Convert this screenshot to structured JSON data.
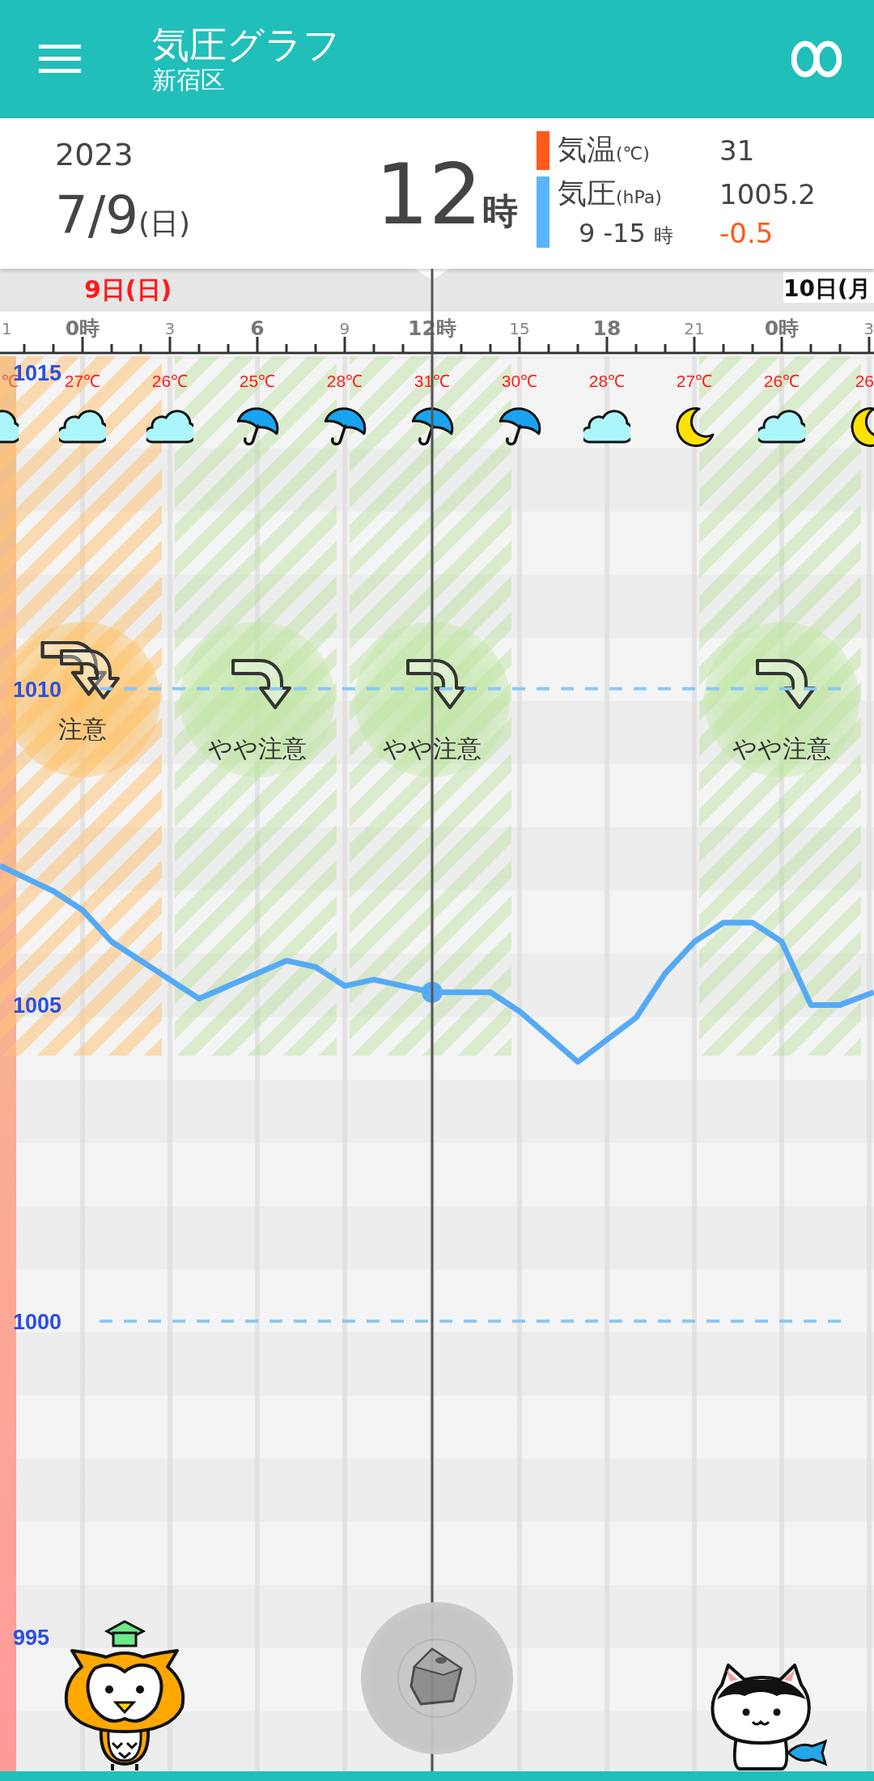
{
  "app_bar": {
    "title": "気圧グラフ",
    "subtitle": "新宿区"
  },
  "current": {
    "year": "2023",
    "date": "7/9",
    "weekday": "(日)",
    "hour": "12",
    "hour_unit": "時"
  },
  "legend": [
    {
      "label": "気温",
      "unit": "(℃)",
      "value": "31",
      "color": "#ff5a1a"
    },
    {
      "label": "気圧",
      "unit": "(hPa)",
      "value": "1005.2",
      "color": "#5ab4ff"
    }
  ],
  "change": {
    "range": "9 -15",
    "unit": "時",
    "value": "-0.5"
  },
  "date_labels": [
    {
      "label": "9日(日)",
      "color": "#ff1a1a"
    },
    {
      "label": "10日(月",
      "color": "#111111"
    }
  ],
  "chart_data": {
    "type": "line",
    "x": [
      -2.83,
      -1,
      0,
      1,
      4,
      7,
      8,
      9,
      10,
      12,
      14,
      15,
      16,
      17,
      19,
      20,
      21,
      22,
      23,
      24,
      25,
      26,
      27.16
    ],
    "series": [
      {
        "color": "#55aaf5",
        "values": [
          1007.2,
          1006.8,
          1006.5,
          1006.0,
          1005.1,
          1005.7,
          1005.6,
          1005.3,
          1005.4,
          1005.2,
          1005.2,
          1004.9,
          1004.5,
          1004.1,
          1004.8,
          1005.5,
          1006.0,
          1006.3,
          1006.3,
          1006.0,
          1005.0,
          1005.0,
          1005.2
        ]
      }
    ],
    "xlim": [
      -2.833,
      27.167
    ],
    "ylim": [
      992.88,
      1015.26
    ],
    "xticks": [
      {
        "value": 0,
        "label": "0時"
      },
      3,
      6,
      9,
      {
        "value": 12,
        "label": "12時"
      },
      15,
      18,
      21
    ],
    "yticks": [
      1015,
      1010,
      1005,
      1000,
      995
    ]
  },
  "forecast": [
    {
      "hour": "1",
      "temp": "℃",
      "kind": "cloud",
      "selected": false
    },
    {
      "temp": "27℃",
      "kind": "cloud",
      "selected": false,
      "alert": {
        "kind": "caution",
        "label": "注意"
      }
    },
    {
      "temp": "26℃",
      "kind": "cloud",
      "selected": false
    },
    {
      "temp": "25℃",
      "kind": "rain",
      "selected": false,
      "alert": {
        "kind": "slight",
        "label": "やや注意"
      }
    },
    {
      "temp": "28℃",
      "kind": "rain",
      "selected": false
    },
    {
      "temp": "31℃",
      "kind": "rain",
      "selected": true,
      "alert": {
        "kind": "slight",
        "label": "やや注意"
      }
    },
    {
      "temp": "30℃",
      "kind": "rain",
      "selected": false
    },
    {
      "temp": "28℃",
      "kind": "cloud",
      "selected": false
    },
    {
      "temp": "27℃",
      "kind": "moon",
      "selected": false
    },
    {
      "hour": "0時",
      "temp": "26℃",
      "kind": "cloud",
      "selected": false,
      "alert": {
        "kind": "slight",
        "label": "やや注意"
      }
    },
    {
      "hour": "3",
      "temp": "26",
      "kind": "moon",
      "selected": false
    }
  ]
}
